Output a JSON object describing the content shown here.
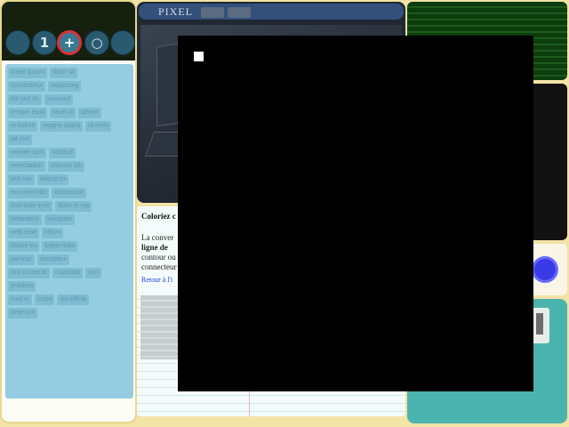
{
  "toolbar": {
    "buttons": [
      {
        "icon": "blank",
        "glyph": ""
      },
      {
        "icon": "number-one-icon",
        "glyph": "1"
      },
      {
        "icon": "plus-icon",
        "glyph": "+",
        "active": true
      },
      {
        "icon": "circle-icon",
        "glyph": "○"
      },
      {
        "icon": "blank",
        "glyph": ""
      }
    ]
  },
  "list": {
    "rows": [
      [
        "lorem ipsum",
        "dolor sit"
      ],
      [
        "consectetur",
        "adipiscing"
      ],
      [
        "elit sed do",
        "eiusmod"
      ],
      [
        "tempor incid",
        "idunt ut",
        "labore"
      ],
      [
        "et dolore",
        "magna aliqua",
        "ut enim",
        "ad min"
      ],
      [
        "veniam quis",
        "nostrud"
      ],
      [
        "exercitation",
        "ullamco lab"
      ],
      [
        "oris nisi",
        "aliquip ex"
      ],
      [
        "ea commodo",
        "consequat"
      ],
      [
        "duis aute irure",
        "dolor in rep"
      ],
      [
        "rehenderit",
        "voluptate"
      ],
      [
        "velit esse",
        "cillum"
      ],
      [
        "dolore eu",
        "fugiat nulla"
      ],
      [
        "pariatur",
        "excepteur"
      ],
      [
        "sint occaecat",
        "cupidatat",
        "non",
        "proident"
      ],
      [
        "sunt in",
        "culpa",
        "qui officia"
      ],
      [
        "deserunt"
      ]
    ]
  },
  "viewer": {
    "title": "PIXEL"
  },
  "article": {
    "title": "Coloriez c",
    "paragraph_lines": [
      "La conver",
      "ligne de",
      "contour ou",
      "connecteur"
    ],
    "link": "Retour à l'i"
  },
  "colors": {
    "accent_red": "#d7323a",
    "play_blue": "#3a3ae8",
    "teal": "#4bb3ad"
  }
}
